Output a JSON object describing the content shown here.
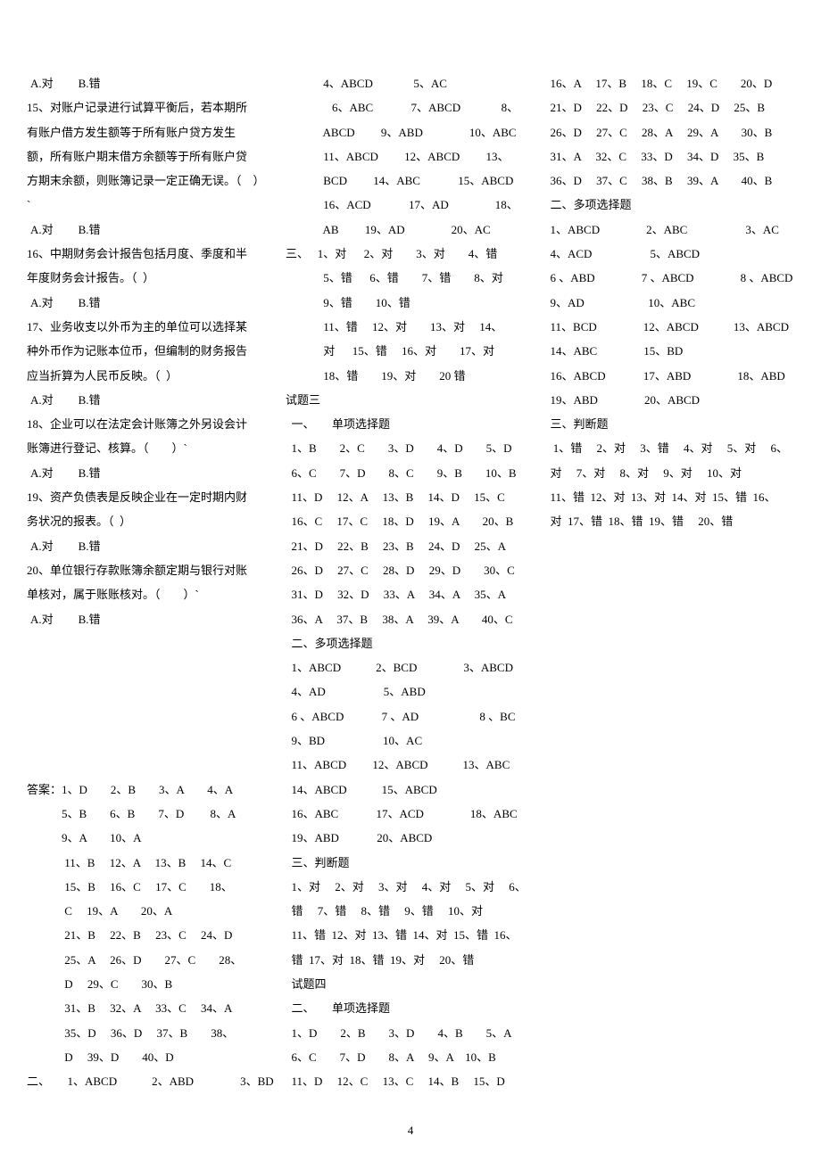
{
  "options": [
    {
      "a": "A.对",
      "b": "B.错"
    }
  ],
  "col1": [
    {
      "type": "opt"
    },
    {
      "t": "15、对账户记录进行试算平衡后，若本期所"
    },
    {
      "t": "有账户借方发生额等于所有账户贷方发生"
    },
    {
      "t": "额，所有账户期末借方余额等于所有账户贷"
    },
    {
      "t": "方期末余额，则账簿记录一定正确无误。（　）"
    },
    {
      "t": "`"
    },
    {
      "type": "opt"
    },
    {
      "t": "16、中期财务会计报告包括月度、季度和半"
    },
    {
      "t": "年度财务会计报告。（  ）"
    },
    {
      "type": "opt"
    },
    {
      "t": "17、业务收支以外币为主的单位可以选择某"
    },
    {
      "t": "种外币作为记账本位币，但编制的财务报告"
    },
    {
      "t": "应当折算为人民币反映。（  ）"
    },
    {
      "type": "opt"
    },
    {
      "t": "18、企业可以在法定会计账簿之外另设会计"
    },
    {
      "t": "账簿进行登记、核算。（　　）`"
    },
    {
      "type": "opt"
    },
    {
      "t": "19、资产负债表是反映企业在一定时期内财"
    },
    {
      "t": "务状况的报表。（  ）"
    },
    {
      "type": "opt"
    },
    {
      "t": "20、单位银行存款账簿余额定期与银行对账"
    },
    {
      "t": "单核对，属于账账核对。（　　）`"
    },
    {
      "type": "opt"
    },
    {
      "t": "　"
    },
    {
      "t": "　"
    },
    {
      "t": "　"
    },
    {
      "t": "　"
    },
    {
      "t": "　"
    },
    {
      "t": "　"
    },
    {
      "t": "答案：1、D　　2、B　　3、A　　4、A"
    },
    {
      "t": "　　　5、B　　6、B　　7、D　　 8、A"
    },
    {
      "t": "　　　9、A　　10、A"
    },
    {
      "t": "　　　 11、B　 12、A　 13、B　 14、C"
    },
    {
      "t": "　　　 15、B　 16、C　 17、C　　18、"
    },
    {
      "t": "　　　 C　 19、A　　20、A"
    },
    {
      "t": "　　　 21、B　 22、B　 23、C　 24、D"
    },
    {
      "t": "　　　 25、A　 26、D　　27、C　　28、"
    },
    {
      "t": "　　　 D　 29、C　　30、B"
    },
    {
      "t": "　　　 31、B　 32、A　 33、C　 34、A"
    },
    {
      "t": "　　　 35、D　 36、D　 37、B　　38、"
    },
    {
      "t": "　　　 D　 39、D　　40、D"
    },
    {
      "t": "二、　　1、ABCD　　　2、ABD　　　　3、BD"
    },
    {
      "t": "　　　 4、ABCD　　　  5、AC"
    },
    {
      "t": "　　　　6、ABC　　　 7、ABCD　　　  8、"
    },
    {
      "t": "　　　 ABCD　　 9、ABD　　　　10、ABC"
    },
    {
      "t": "　　　 11、ABCD　　 12、ABCD　　 13、"
    },
    {
      "t": "　　　 BCD　　 14、ABC　　　 15、ABCD"
    },
    {
      "t": "　　　 16、ACD　　　 17、AD　　　　18、"
    },
    {
      "t": "　　　 AB　　 19、AD　　　　20、AC"
    },
    {
      "t": "三、　 1、对　  2、对　　3、对　　4、错"
    },
    {
      "t": "　　　 5、错　  6、错　　7、错　　8、对"
    },
    {
      "t": "　　　 9、错　　10、错"
    },
    {
      "t": "　　　 11、错　 12、对　　13、对　 14、"
    },
    {
      "t": "　　　 对　  15、错　 16、对　　17、对"
    },
    {
      "t": "　　　 18、错　　19、对　　20 错"
    },
    {
      "t": "试题三"
    },
    {
      "t": "  一、　　单项选择题"
    },
    {
      "t": "  1、B　　2、C　　3、D　　4、D　　5、D"
    },
    {
      "t": "  6、C　　7、D　　8、C　　9、B　　10、B"
    },
    {
      "t": "  11、D　 12、A　 13、B　 14、D　 15、C"
    },
    {
      "t": "  16、C　 17、C　 18、D　 19、A　　20、B"
    },
    {
      "t": "  21、D　 22、B　 23、B　 24、D　 25、A"
    },
    {
      "t": "  26、D　 27、C　 28、D　 29、D　　30、C"
    },
    {
      "t": "  31、D　 32、D　 33、A　 34、A　 35、A"
    },
    {
      "t": "  36、A　 37、B　 38、A　 39、A　　40、C"
    },
    {
      "t": "  二、多项选择题"
    },
    {
      "t": "  1、ABCD　　　2、BCD　　　　3、ABCD"
    },
    {
      "t": "  4、AD　　　　　5、ABD"
    },
    {
      "t": "  6 、ABCD　　　 7 、AD　　　　　 8 、BC"
    },
    {
      "t": "  9、BD　　　　　10、AC"
    },
    {
      "t": "  11、ABCD　　 12、ABCD　　　13、ABC"
    },
    {
      "t": "  14、ABCD　　　15、ABCD"
    },
    {
      "t": "  16、ABC　　　 17、ACD　　　　18、ABC"
    },
    {
      "t": "  19、ABD　　　 20、ABCD"
    },
    {
      "t": "  三、判断题"
    },
    {
      "t": "  1、对　 2、对　 3、对　 4、对　 5、对　 6、"
    },
    {
      "t": "  错　 7、错　 8、错　 9、错　 10、对"
    },
    {
      "t": "  11、错  12、对  13、错  14、对  15、错  16、"
    },
    {
      "t": "  错  17、对  18、错  19、对　 20、错"
    },
    {
      "t": "  试题四"
    },
    {
      "t": "  二、　　单项选择题"
    },
    {
      "t": "  1、D　　2、B　　3、D　　4、B　　5、A"
    },
    {
      "t": "  6、C　　7、D　　8、A　 9、A　10、B"
    },
    {
      "t": "  11、D　 12、C　 13、C　 14、B　 15、D"
    },
    {
      "t": "  16、A　 17、B　 18、C　 19、C　　20、D"
    },
    {
      "t": "  21、D　 22、D　 23、C　 24、D　 25、B"
    },
    {
      "t": "  26、D　 27、C　 28、A　 29、A　　30、B"
    },
    {
      "t": "  31、A　 32、C　 33、D　 34、D　 35、B"
    },
    {
      "t": "  36、D　 37、C　 38、B　 39、A　　40、B"
    },
    {
      "t": "  二、多项选择题"
    },
    {
      "t": "  1、ABCD　　　　2、ABC　　　　　3、AC"
    },
    {
      "t": "  4、ACD　　　　　5、ABCD"
    },
    {
      "t": "  6 、ABD　　　　7 、ABCD　　　　8 、ABCD"
    },
    {
      "t": "  9、AD　　　　　  10、ABC"
    },
    {
      "t": "  11、BCD　　　　12、ABCD　　　13、ABCD"
    },
    {
      "t": "  14、ABC　　　　15、BD"
    },
    {
      "t": "  16、ABCD　　　 17、ABD　　　　18、ABD"
    },
    {
      "t": "  19、ABD　　　　20、ABCD"
    },
    {
      "t": "  三、判断题"
    },
    {
      "t": "   1、错　 2、对　 3、错　 4、对　 5、对　 6、"
    },
    {
      "t": "  对　 7、对　 8、对　 9、对　 10、对"
    },
    {
      "t": "  11、错  12、对  13、对  14、对  15、错  16、"
    },
    {
      "t": "  对  17、错  18、错  19、错　 20、错"
    }
  ],
  "page_number": "4"
}
